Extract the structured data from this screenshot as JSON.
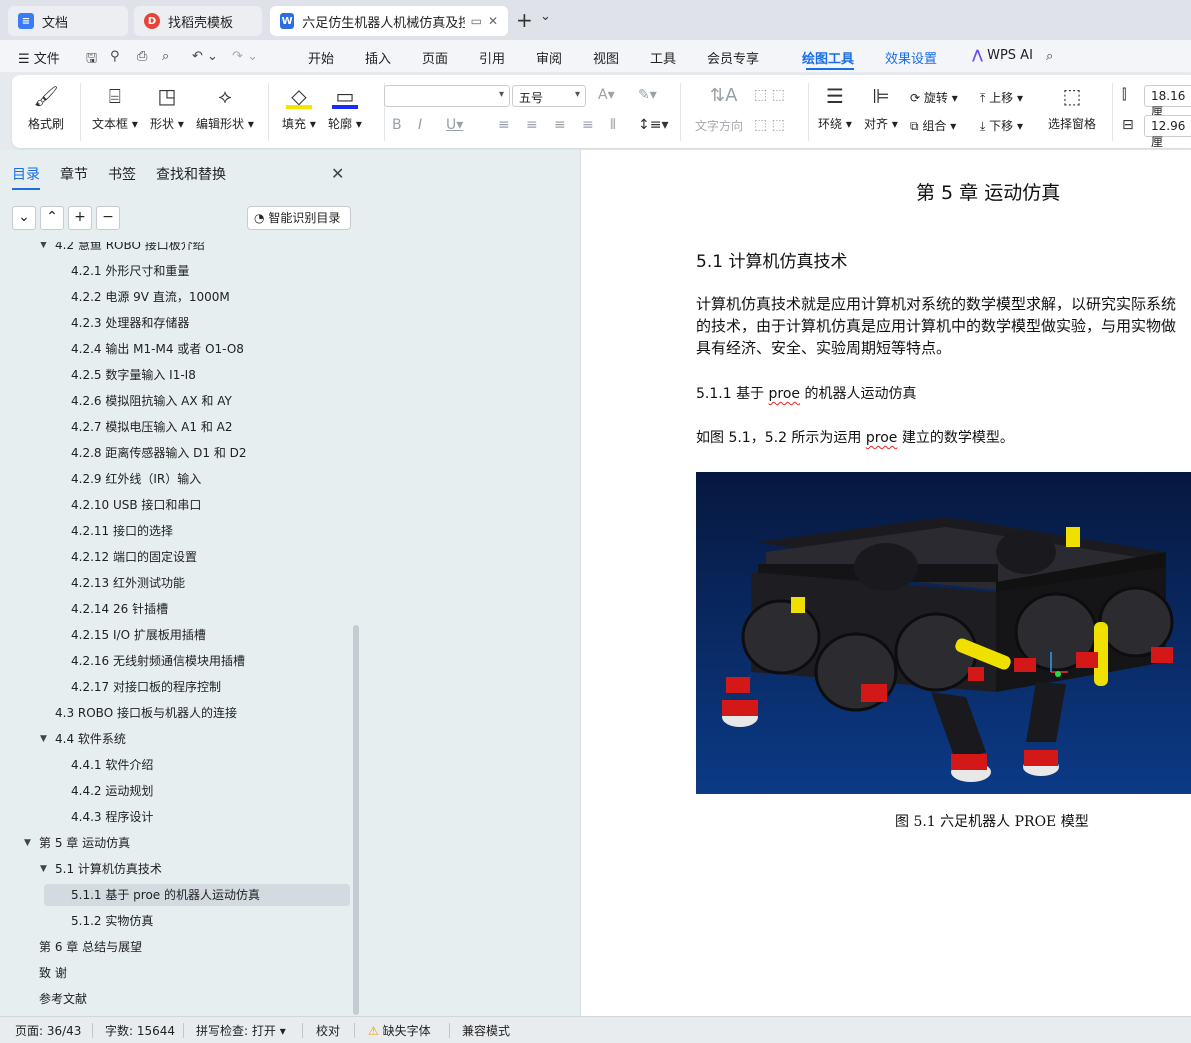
{
  "tabs": [
    {
      "label": "文档",
      "icon": "doc-icon",
      "color": "#3b7cf5"
    },
    {
      "label": "找稻壳模板",
      "icon": "docer-icon",
      "color": "#e8433b"
    },
    {
      "label": "六足仿生机器人机械仿真及控制",
      "icon": "wps-writer-icon",
      "color": "#2f6ce0",
      "active": true
    }
  ],
  "tab_new": "+",
  "tab_more": "⌄",
  "menubar": {
    "file": "文件",
    "items": [
      "开始",
      "插入",
      "页面",
      "引用",
      "审阅",
      "视图",
      "工具",
      "会员专享"
    ],
    "drawing_tools": "绘图工具",
    "effects": "效果设置",
    "wps_ai": "WPS AI"
  },
  "ribbon": {
    "format_painter": "格式刷",
    "textbox": "文本框",
    "shape": "形状",
    "edit_shape": "编辑形状",
    "fill": "填充",
    "outline": "轮廓",
    "font_size": "五号",
    "font_name": "",
    "text_direction": "文字方向",
    "wrap": "环绕",
    "align": "对齐",
    "rotate": "旋转",
    "group": "组合",
    "bring_forward": "上移",
    "send_backward": "下移",
    "selection_pane": "选择窗格",
    "width_value": "18.16厘",
    "height_value": "12.96厘"
  },
  "nav": {
    "tabs": [
      "目录",
      "章节",
      "书签",
      "查找和替换"
    ],
    "smart_toc": "智能识别目录",
    "toc": [
      {
        "label": "4.2 慧鱼 ROBO 接口板介绍",
        "level": 2,
        "expanded": true
      },
      {
        "label": "4.2.1  外形尺寸和重量",
        "level": 3
      },
      {
        "label": "4.2.2  电源 9V 直流，1000M",
        "level": 3
      },
      {
        "label": "4.2.3  处理器和存储器",
        "level": 3
      },
      {
        "label": "4.2.4  输出 M1-M4 或者 O1-O8",
        "level": 3
      },
      {
        "label": "4.2.5  数字量输入 I1-I8",
        "level": 3
      },
      {
        "label": "4.2.6  模拟阻抗输入 AX 和 AY",
        "level": 3
      },
      {
        "label": "4.2.7  模拟电压输入 A1 和 A2",
        "level": 3
      },
      {
        "label": "4.2.8  距离传感器输入 D1 和 D2",
        "level": 3
      },
      {
        "label": "4.2.9  红外线（IR）输入",
        "level": 3
      },
      {
        "label": "4.2.10 USB 接口和串口",
        "level": 3
      },
      {
        "label": "4.2.11  接口的选择",
        "level": 3
      },
      {
        "label": "4.2.12  端口的固定设置",
        "level": 3
      },
      {
        "label": "4.2.13  红外测试功能",
        "level": 3
      },
      {
        "label": "4.2.14 26 针插槽",
        "level": 3
      },
      {
        "label": "4.2.15 I/O 扩展板用插槽",
        "level": 3
      },
      {
        "label": "4.2.16  无线射频通信模块用插槽",
        "level": 3
      },
      {
        "label": "4.2.17 对接口板的程序控制",
        "level": 3
      },
      {
        "label": "4.3 ROBO 接口板与机器人的连接",
        "level": 2
      },
      {
        "label": "4.4 软件系统",
        "level": 2,
        "expanded": true
      },
      {
        "label": "4.4.1 软件介绍",
        "level": 3
      },
      {
        "label": "4.4.2 运动规划",
        "level": 3
      },
      {
        "label": "4.4.3 程序设计",
        "level": 3
      },
      {
        "label": "第 5 章  运动仿真",
        "level": 1,
        "expanded": true
      },
      {
        "label": "5.1 计算机仿真技术",
        "level": 2,
        "expanded": true
      },
      {
        "label": "5.1.1 基于 proe 的机器人运动仿真",
        "level": 3,
        "selected": true
      },
      {
        "label": "5.1.2 实物仿真",
        "level": 3
      },
      {
        "label": "第 6 章    总结与展望",
        "level": 1
      },
      {
        "label": "致    谢",
        "level": 1
      },
      {
        "label": "参考文献",
        "level": 1
      }
    ]
  },
  "document": {
    "chapter_title": "第 5 章  运动仿真",
    "section_title": "5.1 计算机仿真技术",
    "para1_line1": "计算机仿真技术就是应用计算机对系统的数学模型求解，以研究实际系统",
    "para1_line2": "的技术，由于计算机仿真是应用计算机中的数学模型做实验，与用实物做",
    "para1_line3": "具有经济、安全、实验周期短等特点。",
    "subsection_title_pre": "5.1.1 基于 ",
    "subsection_title_proe": "proe",
    "subsection_title_post": " 的机器人运动仿真",
    "para2_pre": "如图 5.1，5.2 所示为运用 ",
    "para2_proe": "proe",
    "para2_post": " 建立的数学模型。",
    "figure_caption": "图 5.1  六足机器人 PROE 模型"
  },
  "status": {
    "page": "页面: 36/43",
    "words": "字数: 15644",
    "spell": "拼写检查: 打开",
    "proof": "校对",
    "missing_font": "缺失字体",
    "compat": "兼容模式"
  }
}
